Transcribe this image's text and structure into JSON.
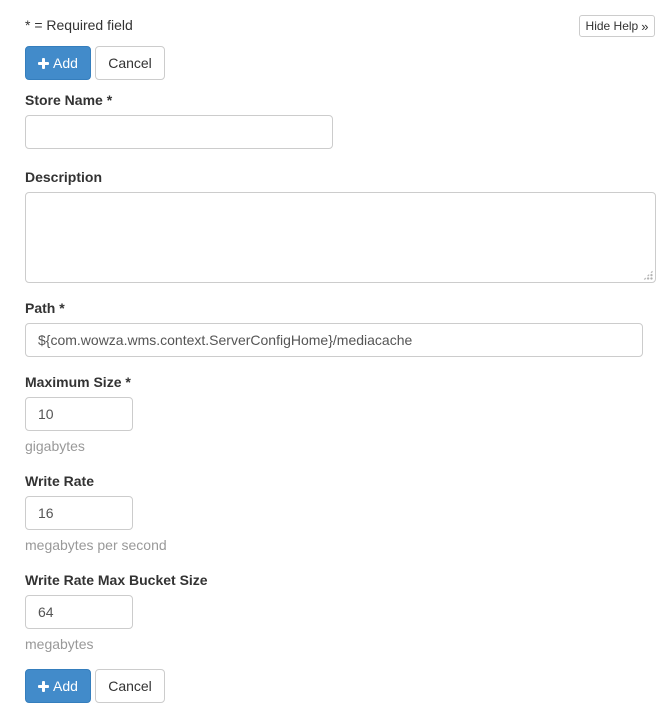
{
  "form": {
    "required_note": "* = Required field",
    "hide_help": {
      "label": "Hide Help",
      "icon": "double-chevron-right-icon"
    },
    "add_label": "Add",
    "add_icon": "plus-icon",
    "cancel_label": "Cancel",
    "fields": {
      "store_name": {
        "label": "Store Name *",
        "value": ""
      },
      "description": {
        "label": "Description",
        "value": ""
      },
      "path": {
        "label": "Path *",
        "value": "${com.wowza.wms.context.ServerConfigHome}/mediacache"
      },
      "max_size": {
        "label": "Maximum Size *",
        "value": "10",
        "help": "gigabytes"
      },
      "write_rate": {
        "label": "Write Rate",
        "value": "16",
        "help": "megabytes per second"
      },
      "bucket_size": {
        "label": "Write Rate Max Bucket Size",
        "value": "64",
        "help": "megabytes"
      }
    }
  },
  "colors": {
    "primary": "#428bca",
    "border": "#cccccc",
    "help_text": "#999999"
  }
}
